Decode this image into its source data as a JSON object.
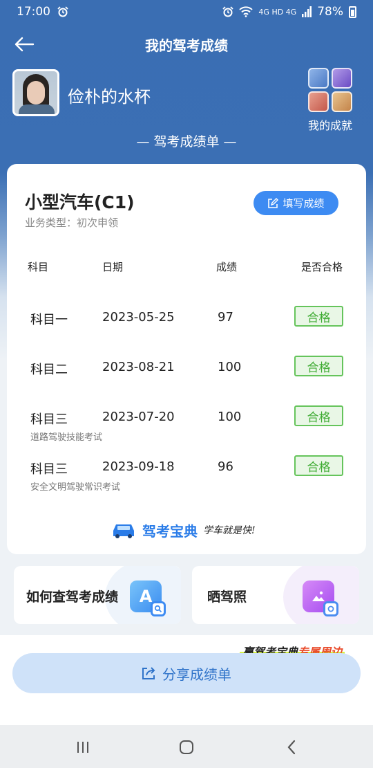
{
  "status_bar": {
    "time": "17:00",
    "network": "4G HD 4G",
    "battery": "78%"
  },
  "header": {
    "title": "我的驾考成绩"
  },
  "profile": {
    "username": "俭朴的水杯",
    "achievements_label": "我的成就"
  },
  "section_title": "— 驾考成绩单 —",
  "card": {
    "vehicle": "小型汽车(C1)",
    "business_type": "业务类型：初次申领",
    "fill_button": "填写成绩",
    "columns": [
      "科目",
      "日期",
      "成绩",
      "是否合格"
    ],
    "rows": [
      {
        "subject": "科目一",
        "date": "2023-05-25",
        "score": "97",
        "status": "合格",
        "note": ""
      },
      {
        "subject": "科目二",
        "date": "2023-08-21",
        "score": "100",
        "status": "合格",
        "note": ""
      },
      {
        "subject": "科目三",
        "date": "2023-07-20",
        "score": "100",
        "status": "合格",
        "note": "道路驾驶技能考试"
      },
      {
        "subject": "科目三",
        "date": "2023-09-18",
        "score": "96",
        "status": "合格",
        "note": "安全文明驾驶常识考试"
      }
    ],
    "brand_name": "驾考宝典",
    "brand_slogan": "学车就是快!"
  },
  "tiles": {
    "left_label": "如何查驾考成绩",
    "left_icon_letter": "A",
    "right_label": "晒驾照"
  },
  "promo": {
    "prefix": "赢驾考宝典",
    "highlight": "专属周边"
  },
  "share_button": "分享成绩单",
  "colors": {
    "primary_blue": "#3a6eb3",
    "accent_blue": "#3d8bf2",
    "pass_green": "#3eab32"
  }
}
